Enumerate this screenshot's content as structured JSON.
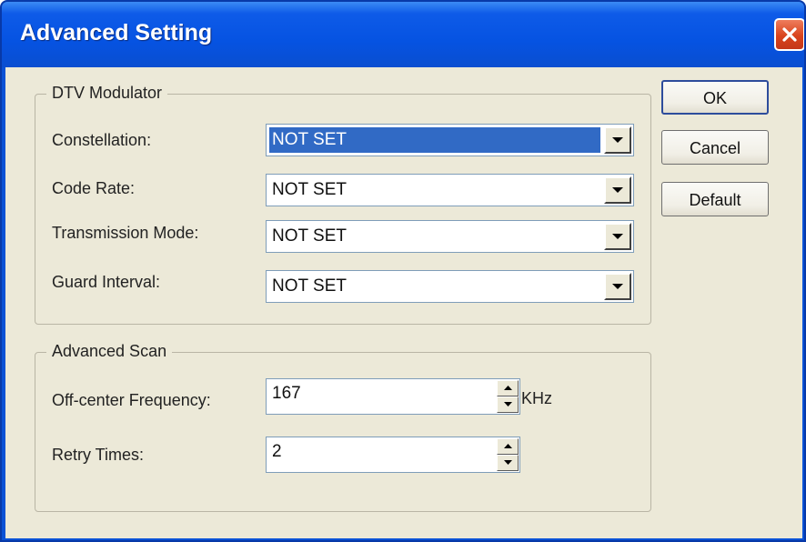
{
  "window": {
    "title": "Advanced Setting",
    "close_glyph": "✕"
  },
  "dtv_modulator": {
    "legend": "DTV Modulator",
    "fields": [
      {
        "label": "Constellation:",
        "value": "NOT SET",
        "selected": true
      },
      {
        "label": "Code Rate:",
        "value": "NOT SET",
        "selected": false
      },
      {
        "label": "Transmission Mode:",
        "value": "NOT SET",
        "selected": false
      },
      {
        "label": "Guard Interval:",
        "value": "NOT SET",
        "selected": false
      }
    ]
  },
  "advanced_scan": {
    "legend": "Advanced Scan",
    "off_center_frequency": {
      "label": "Off-center Frequency:",
      "value": "167",
      "unit": "KHz"
    },
    "retry_times": {
      "label": "Retry Times:",
      "value": "2"
    }
  },
  "buttons": {
    "ok": "OK",
    "cancel": "Cancel",
    "default": "Default"
  },
  "colors": {
    "titlebar": "#0a52d6",
    "client_bg": "#ece9d8",
    "selection": "#316ac5",
    "close_button": "#d9431c"
  },
  "icons": {
    "close": "close-icon",
    "dropdown": "chevron-down-icon",
    "spin_up": "arrow-up-icon",
    "spin_down": "arrow-down-icon"
  }
}
